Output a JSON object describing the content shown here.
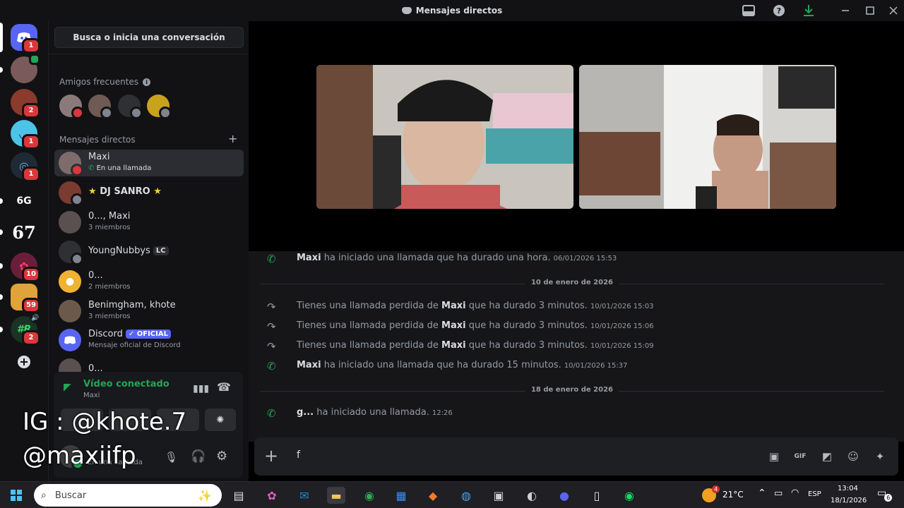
{
  "window": {
    "title": "Mensajes directos"
  },
  "servers": [
    {
      "name": "discord-home",
      "badge": "1"
    },
    {
      "name": "server-1",
      "badge": ""
    },
    {
      "name": "server-2",
      "badge": "2"
    },
    {
      "name": "server-3",
      "badge": "1"
    },
    {
      "name": "server-4",
      "badge": "1"
    },
    {
      "name": "server-6g",
      "label": "6G",
      "badge": ""
    },
    {
      "name": "server-67",
      "label": "67",
      "badge": ""
    },
    {
      "name": "server-8",
      "badge": "10"
    },
    {
      "name": "server-9",
      "badge": "59"
    },
    {
      "name": "server-10",
      "label": "#R",
      "badge": "2"
    }
  ],
  "dm": {
    "search_label": "Busca o inicia una conversación",
    "frequent_title": "Amigos frecuentes",
    "dms_title": "Mensajes directos",
    "items": [
      {
        "name": "Maxi",
        "sub": "En una llamada"
      },
      {
        "name": "DJ SANRO",
        "star": "★"
      },
      {
        "name": "0..., Maxi",
        "sub": "3 miembros"
      },
      {
        "name": "YoungNubbys",
        "tag": "LC"
      },
      {
        "name": "0...",
        "sub": "2 miembros"
      },
      {
        "name": "Benimgham, khote",
        "sub": "3 miembros"
      },
      {
        "name": "Discord",
        "tag": "✓ OFICIAL",
        "sub": "Mensaje oficial de Discord"
      },
      {
        "name": "0..."
      }
    ]
  },
  "voice": {
    "title": "Vídeo conectado",
    "channel": "Maxi",
    "user_status": "En una llamada"
  },
  "overlay": {
    "line1": "IG : @khote.7",
    "line2": "@maxiifp"
  },
  "chat": {
    "messages": [
      {
        "type": "started",
        "who": "Maxi",
        "text": "ha iniciado una llamada que ha durado una hora.",
        "ts": "06/01/2026 15:53"
      },
      {
        "type": "divider",
        "text": "10 de enero de 2026"
      },
      {
        "type": "missed",
        "pre": "Tienes una llamada perdida de",
        "who": "Maxi",
        "text": "que ha durado 3 minutos.",
        "ts": "10/01/2026 15:03"
      },
      {
        "type": "missed",
        "pre": "Tienes una llamada perdida de",
        "who": "Maxi",
        "text": "que ha durado 3 minutos.",
        "ts": "10/01/2026 15:06"
      },
      {
        "type": "missed",
        "pre": "Tienes una llamada perdida de",
        "who": "Maxi",
        "text": "que ha durado 3 minutos.",
        "ts": "10/01/2026 15:09"
      },
      {
        "type": "started",
        "who": "Maxi",
        "text": "ha iniciado una llamada que ha durado 15 minutos.",
        "ts": "10/01/2026 15:37"
      },
      {
        "type": "divider",
        "text": "18 de enero de 2026"
      },
      {
        "type": "started",
        "who": "g...",
        "text": "ha iniciado una llamada.",
        "ts": "12:26"
      }
    ],
    "composer_value": "f"
  },
  "taskbar": {
    "search_placeholder": "Buscar",
    "weather": "21°C",
    "lang": "ESP",
    "time": "13:04",
    "date": "18/1/2026",
    "notif_count": "6",
    "weather_badge": "4"
  },
  "colors": {
    "green": "#23a55a",
    "red": "#da373c",
    "blurple": "#5865f2"
  }
}
